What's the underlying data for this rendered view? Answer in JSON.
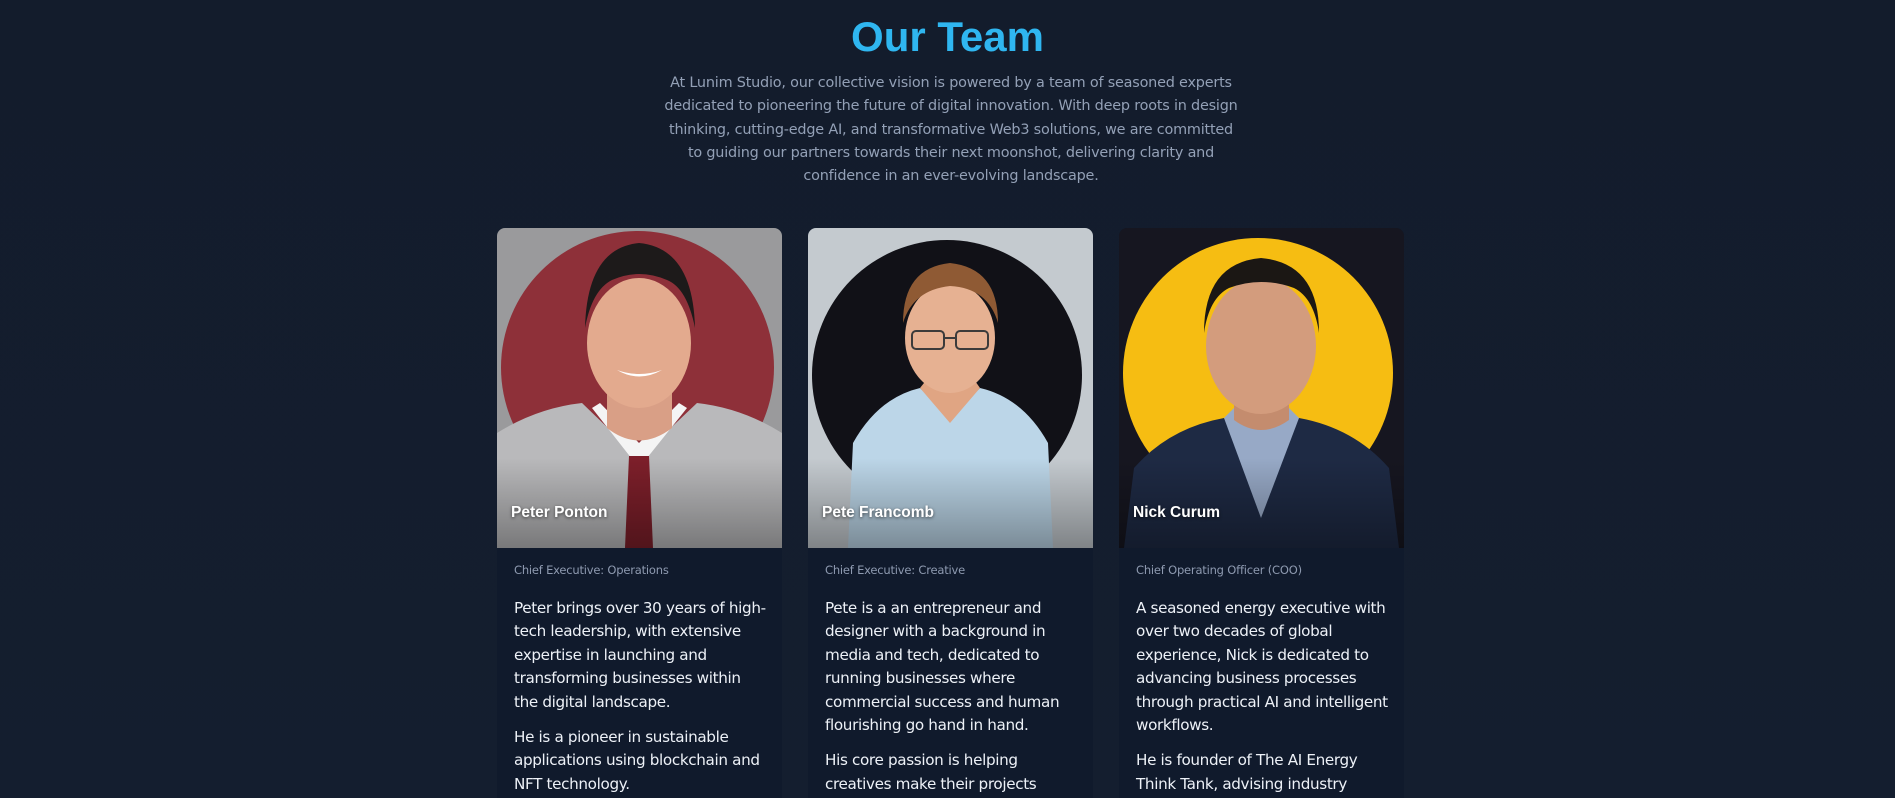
{
  "header": {
    "title": "Our Team",
    "intro": "At Lunim Studio, our collective vision is powered by a team of seasoned experts dedicated to pioneering the future of digital innovation. With deep roots in design thinking, cutting-edge AI, and transformative Web3 solutions, we are committed to guiding our partners towards their next moonshot, delivering clarity and confidence in an ever-evolving landscape."
  },
  "colors": {
    "title": "#2fb6f0",
    "background": "#131c2c",
    "card": "#101a2c"
  },
  "team": [
    {
      "name": "Peter Ponton",
      "role": "Chief Executive: Operations",
      "bio": [
        "Peter brings over 30 years of high-tech leadership, with extensive expertise in launching and transforming businesses within the digital landscape.",
        "He is a pioneer in sustainable applications using blockchain and NFT technology."
      ],
      "photo_accent": "#8e3039"
    },
    {
      "name": "Pete Francomb",
      "role": "Chief Executive: Creative",
      "bio": [
        "Pete is a an entrepreneur and designer with a background in media and tech, dedicated to running businesses where commercial success and human flourishing go hand in hand.",
        "His core passion is helping creatives make their projects happen."
      ],
      "photo_accent": "#111117"
    },
    {
      "name": "Nick Curum",
      "role": "Chief Operating Officer (COO)",
      "bio": [
        "A seasoned energy executive with over two decades of global experience, Nick is dedicated to advancing business processes through practical AI and intelligent workflows.",
        "He is founder of The AI Energy Think Tank, advising industry"
      ],
      "photo_accent": "#f6bd12"
    }
  ]
}
